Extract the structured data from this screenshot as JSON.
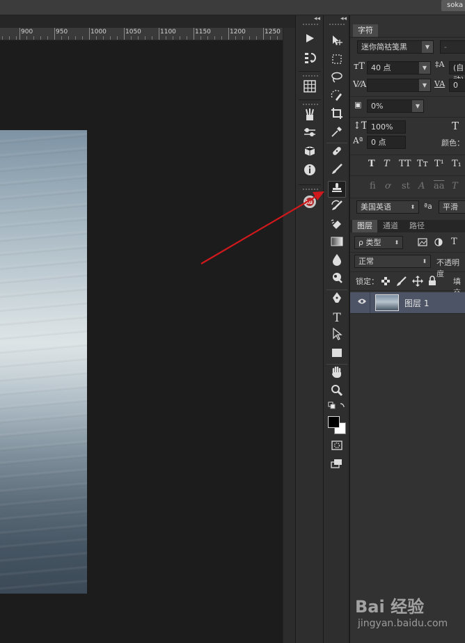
{
  "topbar": {
    "workspace_label": "soka"
  },
  "ruler": {
    "ticks": [
      "900",
      "950",
      "1000",
      "1050",
      "1100",
      "1150",
      "1200",
      "1250"
    ]
  },
  "dock": {
    "collapse_glyph": "◂◂",
    "icons": [
      "play-icon",
      "sort-icon",
      "grid-icon",
      "brushes-icon",
      "brush-presets-icon",
      "3d-icon",
      "info-icon",
      "kuler-icon"
    ]
  },
  "tools": {
    "collapse_glyph": "◂◂",
    "active_tool": "clone-stamp-tool",
    "items": [
      "move",
      "marquee",
      "lasso",
      "quick-select",
      "crop",
      "eyedropper",
      "healing",
      "brush",
      "clone-stamp",
      "history-brush",
      "eraser",
      "gradient",
      "blur",
      "dodge",
      "pen",
      "type",
      "path-select",
      "rectangle",
      "hand",
      "zoom"
    ],
    "type_glyph": "T",
    "foreground_color": "#000000",
    "background_color": "#ffffff"
  },
  "character": {
    "tab_label": "字符",
    "font_family": "迷你简祜笺黑",
    "font_style": "-",
    "font_size": "40 点",
    "leading": "(自动)",
    "kerning": "",
    "tracking": "0",
    "tsume": "0%",
    "vertical_scale": "100%",
    "horizontal_scale_glyph": "T",
    "baseline_shift": "0 点",
    "color_label": "颜色：",
    "style_buttons": [
      "T",
      "T",
      "TT",
      "Tт",
      "T¹",
      "T₁"
    ],
    "opentype_buttons": [
      "fi",
      "ơ",
      "st",
      "A",
      "aa",
      "T"
    ],
    "language": "美国英语",
    "aa_label": "ªa",
    "antialias": "平滑"
  },
  "layers": {
    "tabs": [
      "图层",
      "通道",
      "路径"
    ],
    "filter_label": "ρ 类型",
    "filter_type_glyph": "T",
    "blend_mode": "正常",
    "opacity_label": "不透明度",
    "lock_label": "锁定：",
    "fill_label": "填充",
    "layer_name": "图层 1"
  },
  "watermark": {
    "logo": "Bai 经验",
    "url": "jingyan.baidu.com"
  },
  "colors": {
    "arrow": "#d0191c",
    "accent": "#4d5466"
  }
}
